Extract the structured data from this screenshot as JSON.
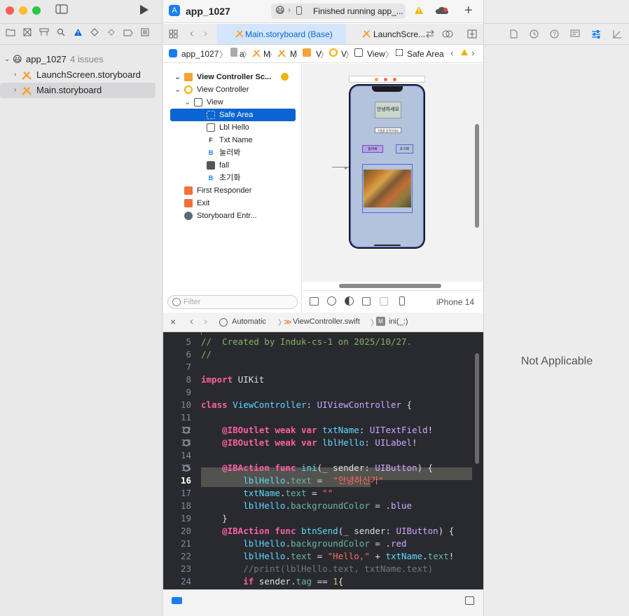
{
  "window": {
    "project_name": "app_1027",
    "activity_status": "Finished running app_...",
    "add_label": "+"
  },
  "navigator": {
    "project_root": "app_1027",
    "issues": "4 issues",
    "files": [
      "LaunchScreen.storyboard",
      "Main.storyboard"
    ]
  },
  "tabs": [
    {
      "label": "Main.storyboard (Base)",
      "active": true
    },
    {
      "label": "LaunchScre...",
      "active": false
    }
  ],
  "jumpbar": {
    "items": [
      "app_1027",
      "a",
      "M",
      "M",
      "V",
      "V",
      "View",
      "Safe Area"
    ]
  },
  "outline": {
    "scene": "View Controller Sc...",
    "items": [
      {
        "label": "View Controller",
        "level": 1,
        "icon": "viewcontroller-icon"
      },
      {
        "label": "View",
        "level": 2,
        "icon": "view-icon"
      },
      {
        "label": "Safe Area",
        "level": 3,
        "icon": "safearea-icon",
        "selected": true
      },
      {
        "label": "Lbl Hello",
        "level": 3,
        "icon": "label-icon"
      },
      {
        "label": "Txt Name",
        "level": 3,
        "icon": "textfield-icon"
      },
      {
        "label": "눌러봐",
        "level": 3,
        "icon": "button-icon"
      },
      {
        "label": "fall",
        "level": 3,
        "icon": "imageview-icon"
      },
      {
        "label": "초기화",
        "level": 3,
        "icon": "button-icon"
      },
      {
        "label": "First Responder",
        "level": 1,
        "icon": "firstresponder-icon"
      },
      {
        "label": "Exit",
        "level": 1,
        "icon": "exit-icon"
      },
      {
        "label": "Storyboard Entr...",
        "level": 1,
        "icon": "entry-icon"
      }
    ],
    "filter_placeholder": "Filter"
  },
  "canvas": {
    "device": "iPhone 14",
    "mock_label": "안녕하세요",
    "mock_textfield": "이름을 입력하세요",
    "mock_button1": "눌러봐",
    "mock_button2": "초기화"
  },
  "codebar": {
    "mode": "Automatic",
    "file": "ViewController.swift",
    "symbol": "ini(_:)"
  },
  "code": {
    "lines": [
      {
        "n": "5",
        "text": "//  Created by Induk-cs-1 on 2025/10/27."
      },
      {
        "n": "6",
        "text": "//"
      },
      {
        "n": "7",
        "text": ""
      },
      {
        "n": "8",
        "text": "import UIKit"
      },
      {
        "n": "9",
        "text": ""
      },
      {
        "n": "10",
        "text": "class ViewController: UIViewController {"
      },
      {
        "n": "11",
        "text": ""
      },
      {
        "n": "12",
        "text": "    @IBOutlet weak var txtName: UITextField!"
      },
      {
        "n": "13",
        "text": "    @IBOutlet weak var lblHello: UILabel!"
      },
      {
        "n": "14",
        "text": ""
      },
      {
        "n": "15",
        "text": "    @IBAction func ini(_ sender: UIButton) {"
      },
      {
        "n": "16",
        "text": "        lblHello.text =  \"안녕하신가\""
      },
      {
        "n": "17",
        "text": "        txtName.text = \"\""
      },
      {
        "n": "18",
        "text": "        lblHello.backgroundColor = .blue"
      },
      {
        "n": "19",
        "text": "    }"
      },
      {
        "n": "20",
        "text": "    @IBAction func btnSend(_ sender: UIButton) {"
      },
      {
        "n": "21",
        "text": "        lblHello.backgroundColor = .red"
      },
      {
        "n": "22",
        "text": "        lblHello.text = \"Hello,\" + txtName.text!"
      },
      {
        "n": "23",
        "text": "        //print(lblHello.text, txtName.text)"
      },
      {
        "n": "24",
        "text": "        if sender.tag == 1{"
      }
    ],
    "current_line": "16"
  },
  "inspector": {
    "placeholder": "Not Applicable"
  },
  "colors": {
    "accent": "#0a64d2",
    "tab_active": "#d4e6fb",
    "code_bg": "#292a30",
    "warning": "#f2b200"
  }
}
